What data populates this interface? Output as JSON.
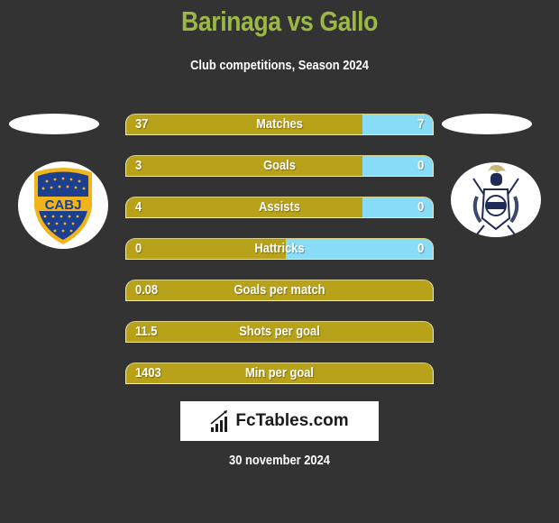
{
  "header": {
    "title": "Barinaga vs Gallo",
    "subtitle": "Club competitions, Season 2024"
  },
  "players": {
    "left": {
      "name": "Barinaga",
      "club_crest": "boca-juniors-crest",
      "crest_text": "CABJ"
    },
    "right": {
      "name": "Gallo",
      "club_crest": "gimnasia-la-plata-crest"
    }
  },
  "colors": {
    "title": "#99b844",
    "left_bar": "#b8a21a",
    "right_bar": "#88dcf6",
    "background": "#333333"
  },
  "stats": [
    {
      "label": "Matches",
      "left": "37",
      "right": "7",
      "left_share": 0.77
    },
    {
      "label": "Goals",
      "left": "3",
      "right": "0",
      "left_share": 0.77
    },
    {
      "label": "Assists",
      "left": "4",
      "right": "0",
      "left_share": 0.77
    },
    {
      "label": "Hattricks",
      "left": "0",
      "right": "0",
      "left_share": 0.52
    },
    {
      "label": "Goals per match",
      "left": "0.08",
      "right": "",
      "left_share": 1
    },
    {
      "label": "Shots per goal",
      "left": "11.5",
      "right": "",
      "left_share": 1
    },
    {
      "label": "Min per goal",
      "left": "1403",
      "right": "",
      "left_share": 1
    }
  ],
  "brand": {
    "name": "FcTables.com",
    "icon": "bar-chart-icon"
  },
  "footer": {
    "date": "30 november 2024"
  }
}
